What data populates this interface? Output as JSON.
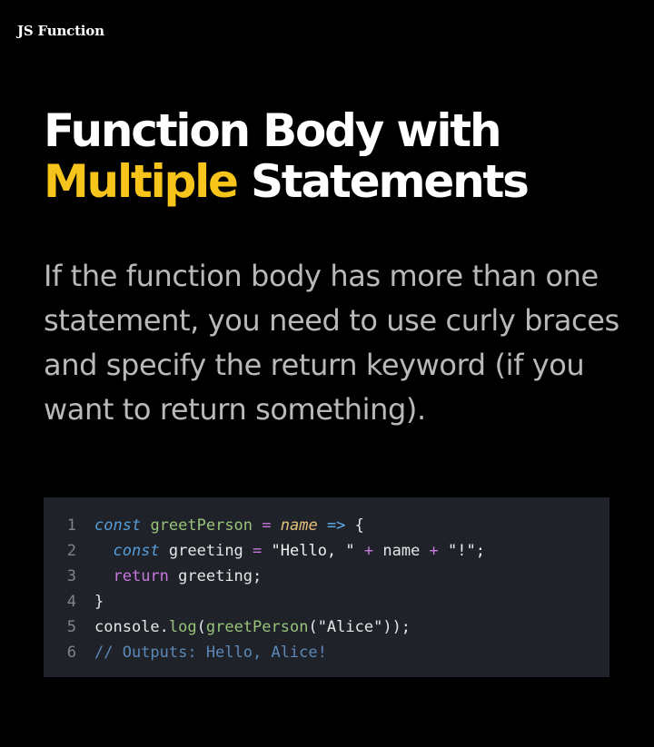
{
  "header": {
    "brand": "JS Function"
  },
  "title": {
    "line1": "Function Body with",
    "highlight": "Multiple",
    "line2_rest": " Statements"
  },
  "description": "If the function body has more than one statement, you need to use curly braces and specify the return keyword (if you want to return something).",
  "colors": {
    "background": "#000000",
    "highlight": "#f7c41b",
    "code_background": "#1f2229"
  },
  "code": {
    "lines": [
      {
        "number": "1",
        "indent": "",
        "tokens": [
          {
            "text": "const",
            "kind": "kw"
          },
          {
            "text": " ",
            "kind": "plain"
          },
          {
            "text": "greetPerson",
            "kind": "fn"
          },
          {
            "text": " = ",
            "kind": "op"
          },
          {
            "text": "name",
            "kind": "param"
          },
          {
            "text": " => ",
            "kind": "arrow"
          },
          {
            "text": "{",
            "kind": "plain"
          }
        ]
      },
      {
        "number": "2",
        "indent": "  ",
        "tokens": [
          {
            "text": "const",
            "kind": "kw"
          },
          {
            "text": " greeting ",
            "kind": "plain"
          },
          {
            "text": "=",
            "kind": "op"
          },
          {
            "text": " \"Hello, \" ",
            "kind": "str"
          },
          {
            "text": "+",
            "kind": "op"
          },
          {
            "text": " name ",
            "kind": "plain"
          },
          {
            "text": "+",
            "kind": "op"
          },
          {
            "text": " \"!\";",
            "kind": "str"
          }
        ]
      },
      {
        "number": "3",
        "indent": "  ",
        "tokens": [
          {
            "text": "return",
            "kind": "ret"
          },
          {
            "text": " greeting;",
            "kind": "plain"
          }
        ]
      },
      {
        "number": "4",
        "indent": "",
        "tokens": [
          {
            "text": "}",
            "kind": "plain"
          }
        ]
      },
      {
        "number": "5",
        "indent": "",
        "tokens": [
          {
            "text": "console.",
            "kind": "plain"
          },
          {
            "text": "log",
            "kind": "fn"
          },
          {
            "text": "(",
            "kind": "plain"
          },
          {
            "text": "greetPerson",
            "kind": "fn"
          },
          {
            "text": "(\"Alice\"));",
            "kind": "plain"
          }
        ]
      },
      {
        "number": "6",
        "indent": "",
        "tokens": [
          {
            "text": "// Outputs: Hello, Alice!",
            "kind": "comment"
          }
        ]
      }
    ]
  }
}
